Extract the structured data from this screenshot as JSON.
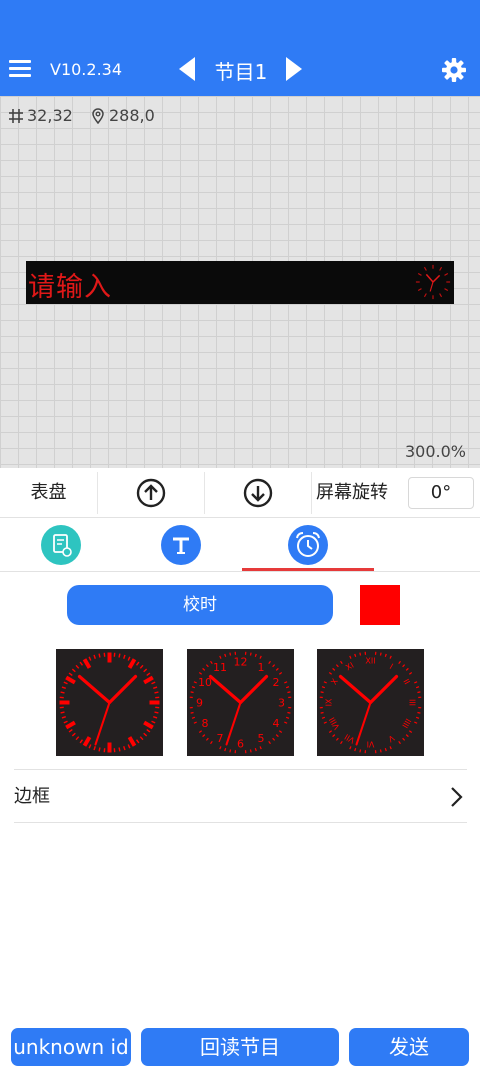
{
  "header": {
    "version": "V10.2.34",
    "program_title": "节目1",
    "icons": [
      "menu-icon",
      "arrow-left-icon",
      "arrow-right-icon",
      "gear-icon"
    ]
  },
  "canvas": {
    "size_text": "32,32",
    "position_text": "288,0",
    "led_text": "请输入",
    "led_color": "#e01818",
    "zoom": "300.0%"
  },
  "toolbar": {
    "dial_label": "表盘",
    "move_up_icon": "arrow-up-circle-icon",
    "move_down_icon": "arrow-down-circle-icon",
    "rotate_label": "屏幕旋转",
    "rotate_value": "0°"
  },
  "tabs": [
    {
      "icon": "document-settings-icon",
      "color": "#2ec4c0",
      "active": false
    },
    {
      "icon": "text-icon",
      "color": "#2f7bf5",
      "active": false
    },
    {
      "icon": "alarm-clock-icon",
      "color": "#2f7bf5",
      "active": true
    }
  ],
  "clock_panel": {
    "sync_label": "校时",
    "color": "#ff0000",
    "dials": [
      {
        "style": "ticks",
        "numbers": []
      },
      {
        "style": "arabic",
        "numbers": [
          "12",
          "1",
          "2",
          "3",
          "4",
          "5",
          "6",
          "7",
          "8",
          "9",
          "10",
          "11"
        ]
      },
      {
        "style": "roman",
        "numbers": [
          "XII",
          "I",
          "II",
          "III",
          "IIII",
          "V",
          "VI",
          "VII",
          "VIII",
          "IX",
          "X",
          "XI"
        ]
      }
    ]
  },
  "border": {
    "label": "边框"
  },
  "bottom": {
    "id_label": "unknown id",
    "readback_label": "回读节目",
    "send_label": "发送"
  },
  "colors": {
    "accent": "#2f7bf5",
    "active_tab_underline": "#e63a3a",
    "dial_bg": "#231f20"
  }
}
